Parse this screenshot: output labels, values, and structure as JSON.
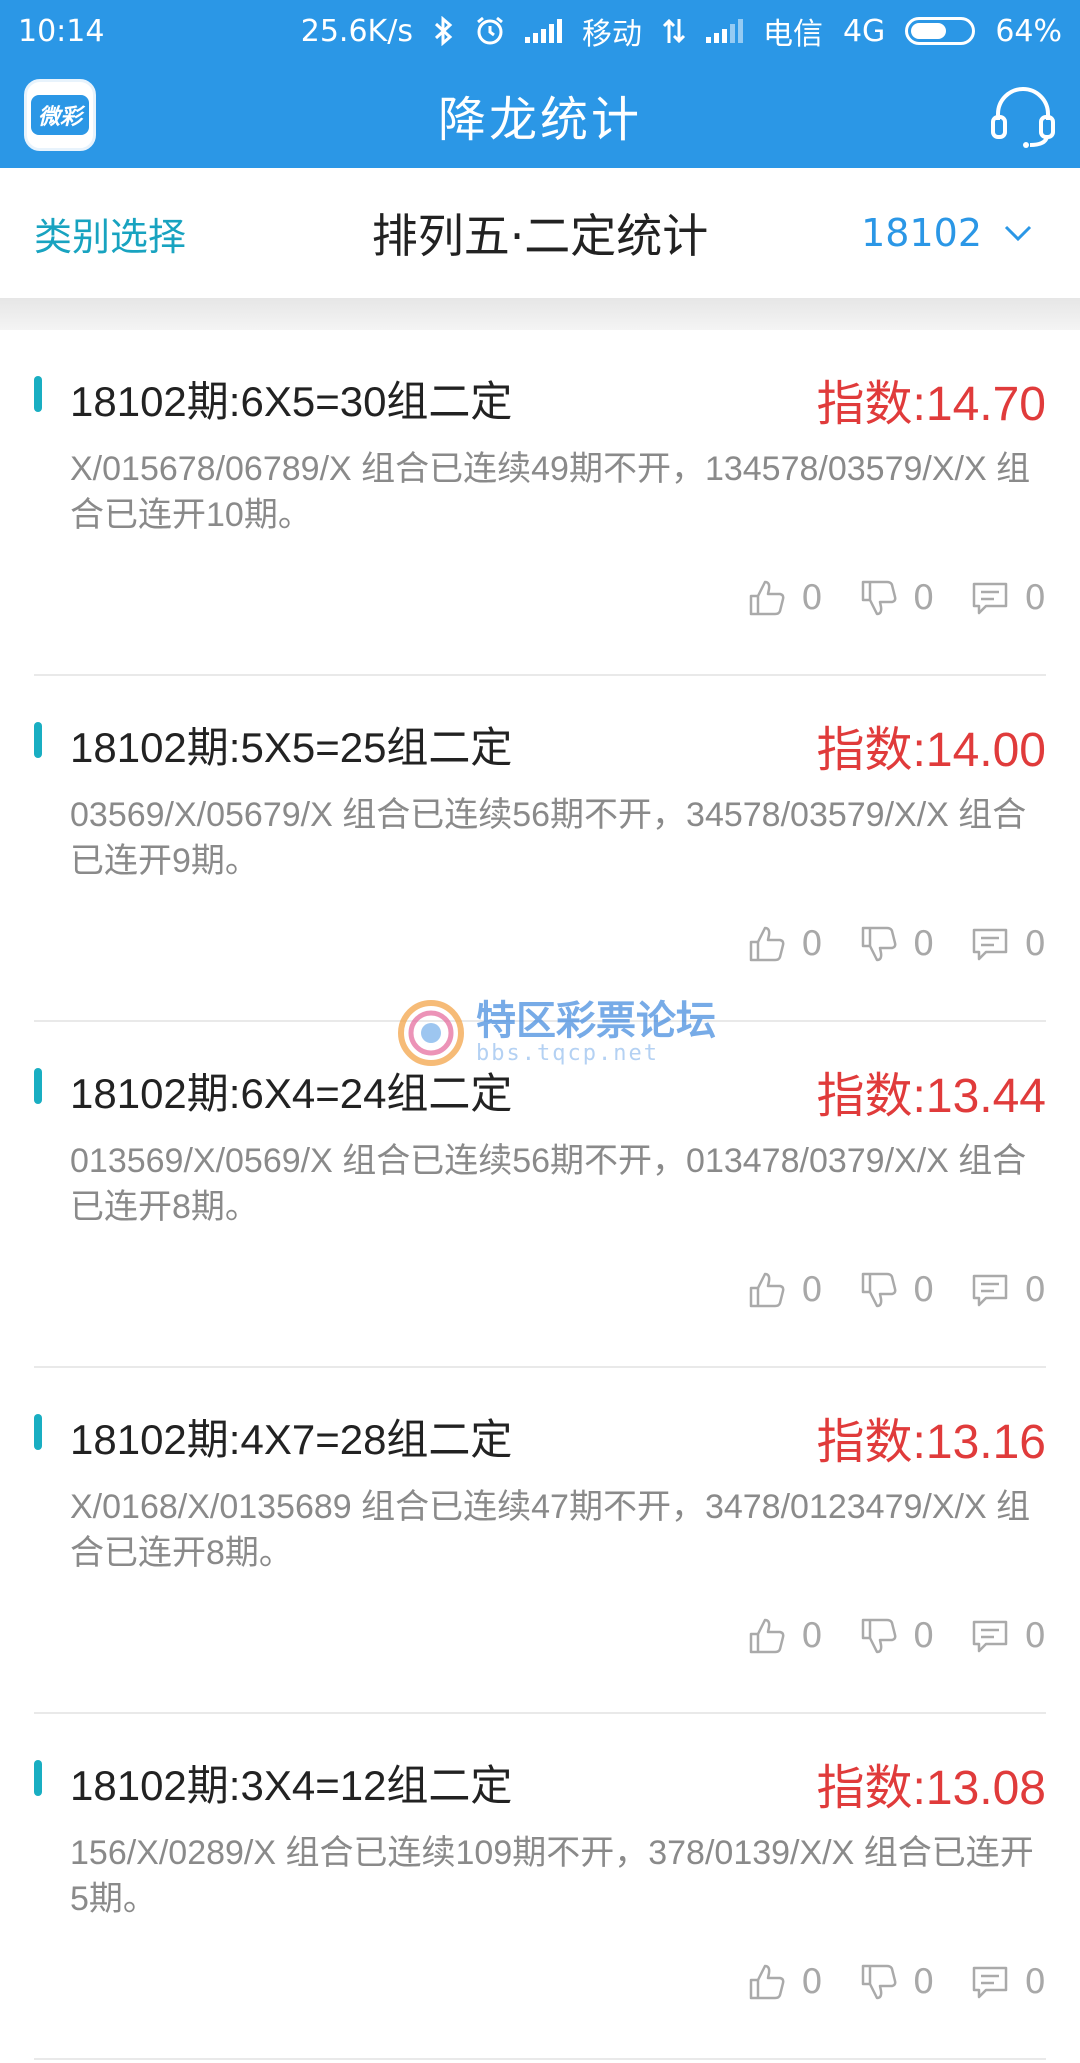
{
  "status_bar": {
    "time": "10:14",
    "speed": "25.6K/s",
    "carrier1": "移动",
    "carrier2": "电信",
    "network": "4G",
    "battery": "64%",
    "battery_level": 0.64,
    "icons": [
      "bluetooth-icon",
      "alarm-icon",
      "signal-icon",
      "data-transfer-icon"
    ]
  },
  "app_bar": {
    "logo_text": "微彩",
    "title": "降龙统计",
    "support_icon": "headset-icon"
  },
  "filter_bar": {
    "category_label": "类别选择",
    "section_title": "排列五·二定统计",
    "issue": "18102"
  },
  "colors": {
    "primary": "#2b97e6",
    "accent_teal": "#19aec2",
    "index_red": "#e03b3b",
    "desc_gray": "#8a8a8a"
  },
  "items": [
    {
      "title": "18102期:6X5=30组二定",
      "index": "指数:14.70",
      "desc": "X/015678/06789/X 组合已连续49期不开，134578/03579/X/X 组合已连开10期。",
      "likes": "0",
      "dislikes": "0",
      "comments": "0"
    },
    {
      "title": "18102期:5X5=25组二定",
      "index": "指数:14.00",
      "desc": "03569/X/05679/X 组合已连续56期不开，34578/03579/X/X 组合已连开9期。",
      "likes": "0",
      "dislikes": "0",
      "comments": "0"
    },
    {
      "title": "18102期:6X4=24组二定",
      "index": "指数:13.44",
      "desc": "013569/X/0569/X 组合已连续56期不开，013478/0379/X/X 组合已连开8期。",
      "likes": "0",
      "dislikes": "0",
      "comments": "0"
    },
    {
      "title": "18102期:4X7=28组二定",
      "index": "指数:13.16",
      "desc": "X/0168/X/0135689 组合已连续47期不开，3478/0123479/X/X 组合已连开8期。",
      "likes": "0",
      "dislikes": "0",
      "comments": "0"
    },
    {
      "title": "18102期:3X4=12组二定",
      "index": "指数:13.08",
      "desc": "156/X/0289/X 组合已连续109期不开，378/0139/X/X 组合已连开5期。",
      "likes": "0",
      "dislikes": "0",
      "comments": "0"
    }
  ],
  "watermark": {
    "text": "特区彩票论坛",
    "sub": "bbs.tqcp.net"
  }
}
